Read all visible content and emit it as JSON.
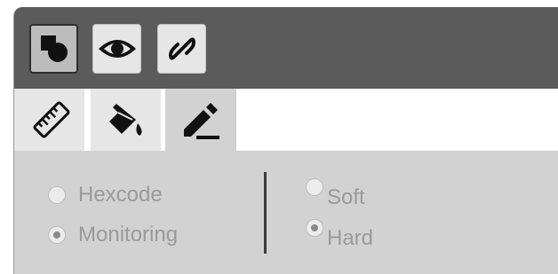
{
  "toolbar": {
    "buttons": [
      {
        "icon": "shapes-icon",
        "active": true
      },
      {
        "icon": "eye-icon",
        "active": false
      },
      {
        "icon": "link-icon",
        "active": false
      }
    ]
  },
  "tabs": [
    {
      "icon": "ruler-icon",
      "active": false
    },
    {
      "icon": "paint-bucket-icon",
      "active": false
    },
    {
      "icon": "pencil-icon",
      "active": true
    }
  ],
  "options": {
    "group1": [
      {
        "label": "Hexcode",
        "checked": false
      },
      {
        "label": "Monitoring",
        "checked": true
      }
    ],
    "group2": [
      {
        "label": "Soft",
        "checked": false
      },
      {
        "label": "Hard",
        "checked": true
      }
    ]
  },
  "colors": {
    "toolbar_bg": "#5b5b5b",
    "panel_bg": "#d2d2d2",
    "tab_bg": "#e6e6e6",
    "label_text": "#9a9a9a",
    "icon": "#111111"
  }
}
